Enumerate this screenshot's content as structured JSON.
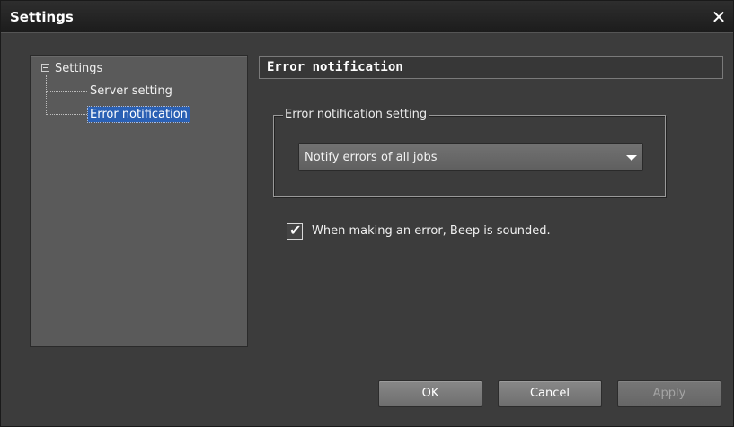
{
  "window": {
    "title": "Settings",
    "close_glyph": "✕"
  },
  "tree": {
    "root_label": "Settings",
    "children": [
      "Server setting",
      "Error notification"
    ],
    "selected_index": 1
  },
  "section": {
    "title": "Error notification"
  },
  "error_group": {
    "legend": "Error notification setting",
    "dropdown_value": "Notify errors of all jobs"
  },
  "beep_checkbox": {
    "label": "When making an error, Beep is sounded.",
    "checked": true,
    "check_glyph": "✔"
  },
  "buttons": {
    "ok": "OK",
    "cancel": "Cancel",
    "apply": "Apply"
  },
  "colors": {
    "selection": "#2a60b4",
    "window_bg": "#3c3c3c",
    "tree_bg": "#5a5a5a"
  },
  "icons": {
    "close": "close-icon",
    "expander": "collapse-icon",
    "dropdown": "chevron-down-icon",
    "check": "checkmark-icon"
  }
}
